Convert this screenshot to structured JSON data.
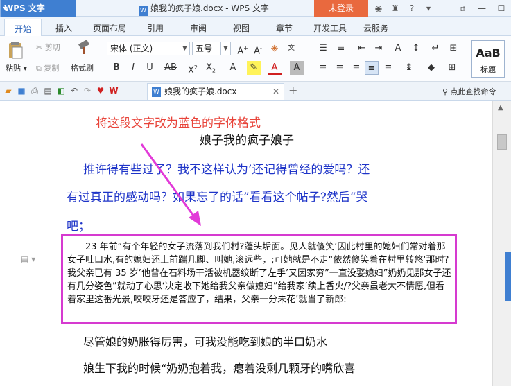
{
  "titlebar": {
    "app_name": "WPS 文字",
    "document_title": "娘我的疯子娘.docx - WPS 文字",
    "login_label": "未登录"
  },
  "tabs": [
    "开始",
    "插入",
    "页面布局",
    "引用",
    "审阅",
    "视图",
    "章节",
    "开发工具",
    "云服务"
  ],
  "ribbon": {
    "paste_label": "粘贴",
    "cut_label": "剪切",
    "copy_label": "复制",
    "format_painter_label": "格式刷",
    "font_name": "宋体 (正文)",
    "font_size": "五号",
    "style_sample": "AaB",
    "style_label": "标题"
  },
  "quick_access": {
    "doc_tab_label": "娘我的疯子娘.docx",
    "search_command_label": "点此查找命令"
  },
  "document": {
    "red_note": "将这段文字改为蓝色的字体格式",
    "heading": "娘子我的疯子娘子",
    "blue_lines": [
      "推许得有些过了？我不这样认为’还记得曾经的爱吗？还",
      "有过真正的感动吗？如果忘了的话”看看这个帖子?然后“哭",
      "吧；"
    ],
    "boxed_paragraph": "23 年前“有个年轻的女子流落到我们村?蓬头垢面。见人就傻笑’因此村里的媳妇们常对着那女子吐口水,有的媳妇还上前踹几脚、叫她,滚远些，;可她就是不走“依然傻笑着在村里转悠‘那时?我父亲已有 35 岁’他曾在石料场干活被机器绞断了左手’又因家穷”一直没娶媳妇”奶奶见那女子还有几分姿色”就动了心思‘决定收下她给我父亲做媳妇”给我家’续上香火/?父亲虽老大不情愿,但看着家里这番光景,咬咬牙还是答应了，结果，父亲一分未花’就当了新郎:",
    "black_lines": [
      "尽管娘的奶胀得厉害，可我没能吃到娘的半口奶水",
      "娘生下我的时候“奶奶抱着我，瘪着没剩几颗牙的嘴欣喜"
    ]
  },
  "colors": {
    "accent": "#3f7fd1",
    "login": "#e9693e",
    "red_note": "#e8443a",
    "blue_text": "#1e34c8",
    "highlight_box": "#d63ad0"
  }
}
